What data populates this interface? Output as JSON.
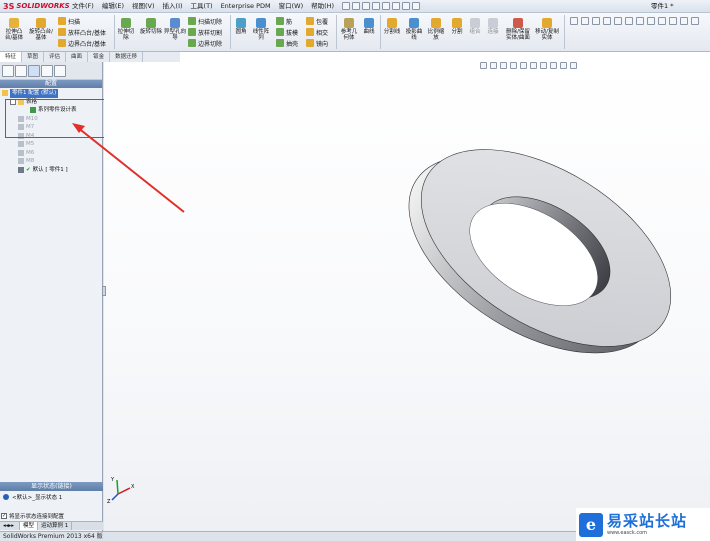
{
  "app": {
    "brand_ds": "3S",
    "brand_name": "SOLIDWORKS",
    "document_title": "零件1 *"
  },
  "menu": [
    "文件(F)",
    "编辑(E)",
    "视图(V)",
    "插入(I)",
    "工具(T)",
    "Enterprise PDM",
    "窗口(W)",
    "帮助(H)"
  ],
  "ribbon": {
    "extrude_boss": "拉伸凸台/基体",
    "revolve_boss": "旋转凸台/基体",
    "sweep": "扫描",
    "loft_boss": "放样凸台/基体",
    "boundary_boss": "边界凸台/基体",
    "extrude_cut": "拉伸切除",
    "revolve_cut": "旋转切除",
    "hole_wizard": "异型孔向导",
    "swept_cut": "扫描切除",
    "lofted_cut": "放样切割",
    "boundary_cut": "边界切除",
    "fillet": "圆角",
    "linear_pattern": "线性阵列",
    "rib": "筋",
    "draft": "拔模",
    "shell": "抽壳",
    "wrap": "包覆",
    "intersect": "相交",
    "mirror": "镜向",
    "ref_geometry": "参考几何体",
    "curves": "曲线",
    "split_line": "分割线",
    "project_curve": "投影曲线",
    "scale": "比例缩放",
    "split": "分割",
    "combine": "组合",
    "join": "连接",
    "delete_body": "删除/保留实体/曲面",
    "move_body": "移动/复制实体"
  },
  "command_tabs": [
    "特征",
    "草图",
    "评估",
    "曲面",
    "钣金",
    "数据迁移"
  ],
  "panel": {
    "header": "配置",
    "root": "零件1 配置 (默认)",
    "tables_folder": "表格",
    "design_table": "系列零件设计表",
    "configs": [
      "M10",
      "M7",
      "M4",
      "M5",
      "M6",
      "M8"
    ],
    "default_config": "默认 [ 零件1 ]",
    "display_state_header": "显示状态(链接)",
    "display_state_item": "<默认>_显示状态 1",
    "link_option": "将显示状态连接到配置"
  },
  "bottom_tabs": [
    "模型",
    "运动算例 1"
  ],
  "status_bar": "SolidWorks Premium 2013 x64 版",
  "watermark": {
    "icon_letter": "e",
    "title": "易采站长站",
    "subtitle": "www.easck.com"
  },
  "colors": {
    "accent": "#3d72c4",
    "highlight": "#e0302b",
    "brand_red": "#c8102e",
    "watermark_blue": "#1e6fd9"
  }
}
